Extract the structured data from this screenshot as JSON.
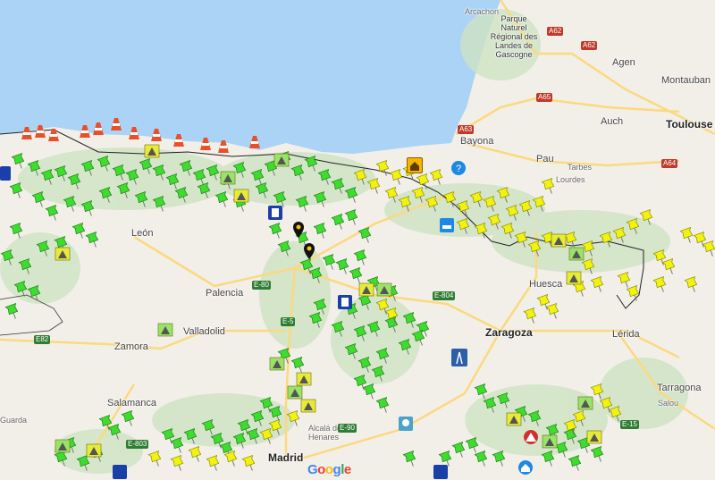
{
  "map": {
    "provider": "Google",
    "google_logo_text": "Google",
    "google_logo_colors": [
      "#4285F4",
      "#EA4335",
      "#FBBC05",
      "#4285F4",
      "#34A853",
      "#EA4335"
    ],
    "land_color": "#f2efe9",
    "sea_color": "#aad3f5",
    "park_color": "#cde3c3",
    "road_color": "#fcd97e",
    "border_color": "#222222"
  },
  "places": {
    "park": [
      "Parque",
      "Naturel",
      "Régional des",
      "Landes de",
      "Gascogne"
    ],
    "arcachon": "Arcachon",
    "agen": "Agen",
    "montauban": "Montauban",
    "auch": "Auch",
    "toulouse": "Toulouse",
    "bayonne": "Bayona",
    "pau": "Pau",
    "tarbes": "Tarbes",
    "lourdes": "Lourdes",
    "leon": "León",
    "palencia": "Palencia",
    "valladolid": "Valladolid",
    "zamora": "Zamora",
    "salamanca": "Salamanca",
    "madrid": "Madrid",
    "alcala": [
      "Alcalá de",
      "Henares"
    ],
    "huesca": "Huesca",
    "zaragoza": "Zaragoza",
    "lerida": "Lérida",
    "tarragona": "Tarragona",
    "salou": "Salou",
    "guarda": "Guarda"
  },
  "road_shields": {
    "a62a": "A62",
    "a62b": "A62",
    "a65": "A65",
    "a63": "A63",
    "a64": "A64",
    "e80": "E-80",
    "e5": "E-5",
    "e804": "E-804",
    "e82": "E82",
    "e90": "E-90",
    "e803": "E-803",
    "e15": "E-15"
  },
  "legend_markers": {
    "green_pin": "green-pushpin",
    "yellow_pin": "yellow-pushpin",
    "cone": "traffic-cone",
    "warning": "warning"
  }
}
